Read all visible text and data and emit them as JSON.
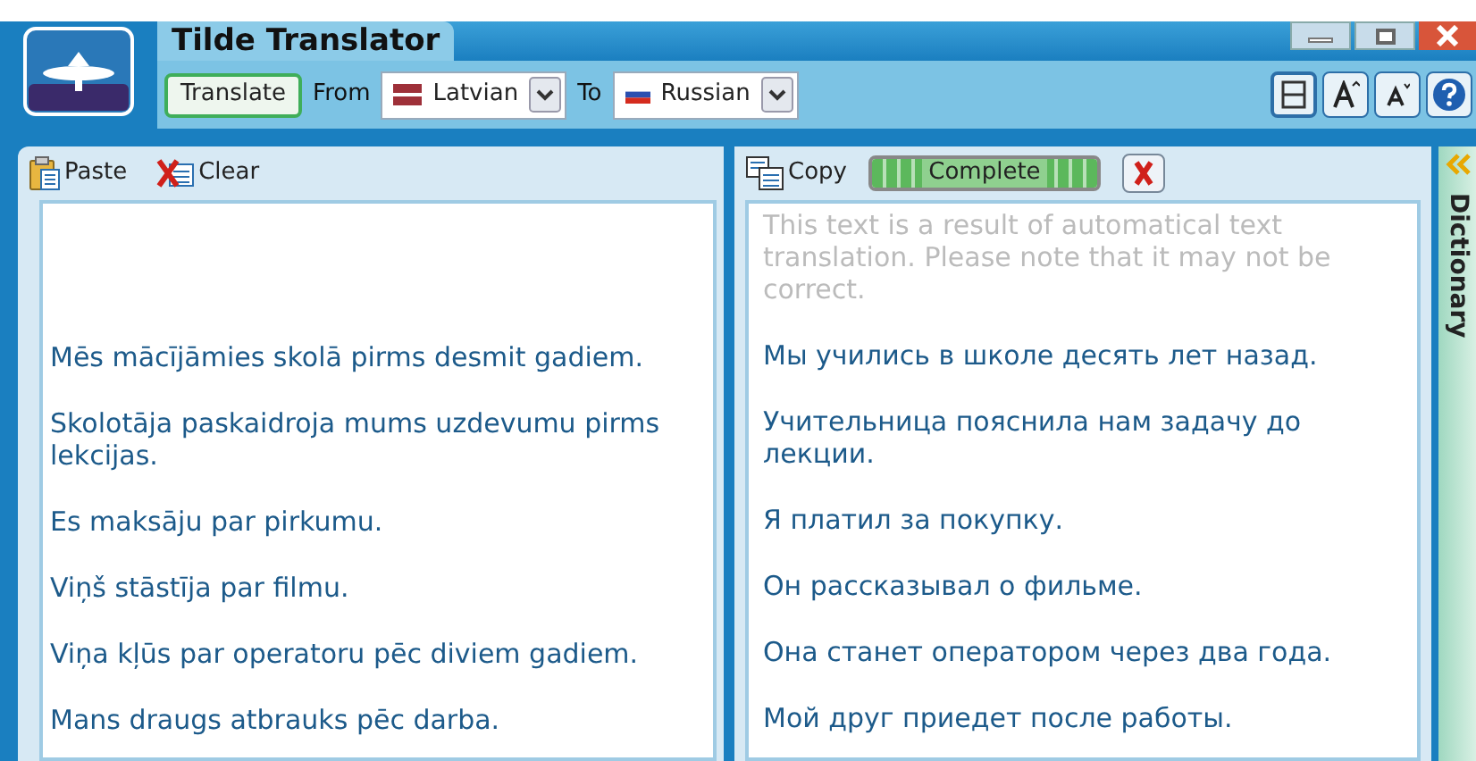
{
  "window": {
    "title": "Tilde Translator"
  },
  "toolbar": {
    "translate_button": "Translate",
    "from_label": "From",
    "from_language": "Latvian",
    "to_label": "To",
    "to_language": "Russian"
  },
  "source_panel": {
    "actions": [
      "Paste",
      "Clear"
    ],
    "sentences": [
      "Mēs mācījāmies skolā pirms desmit gadiem.",
      "Skolotāja paskaidroja mums uzdevumu pirms lekcijas.",
      "Es maksāju par pirkumu.",
      "Viņš stāstīja par filmu.",
      "Viņa kļūs par operatoru pēc diviem gadiem.",
      "Mans draugs atbrauks pēc darba."
    ]
  },
  "target_panel": {
    "copy_button": "Copy",
    "progress": {
      "label": "Complete",
      "level": 1
    },
    "notice": "This text is a result of automatical text translation. Please note that it may not be correct.",
    "sentences": [
      "Мы учились в школе десять лет назад.",
      "Учительница пояснила нам задачу до лекции.",
      "Я платил за покупку.",
      "Он рассказывал о фильме.",
      "Она станет оператором через два года.",
      "Мой друг приедет после работы."
    ]
  },
  "side_tab": {
    "label": "Dictionary",
    "collapsed": true
  }
}
